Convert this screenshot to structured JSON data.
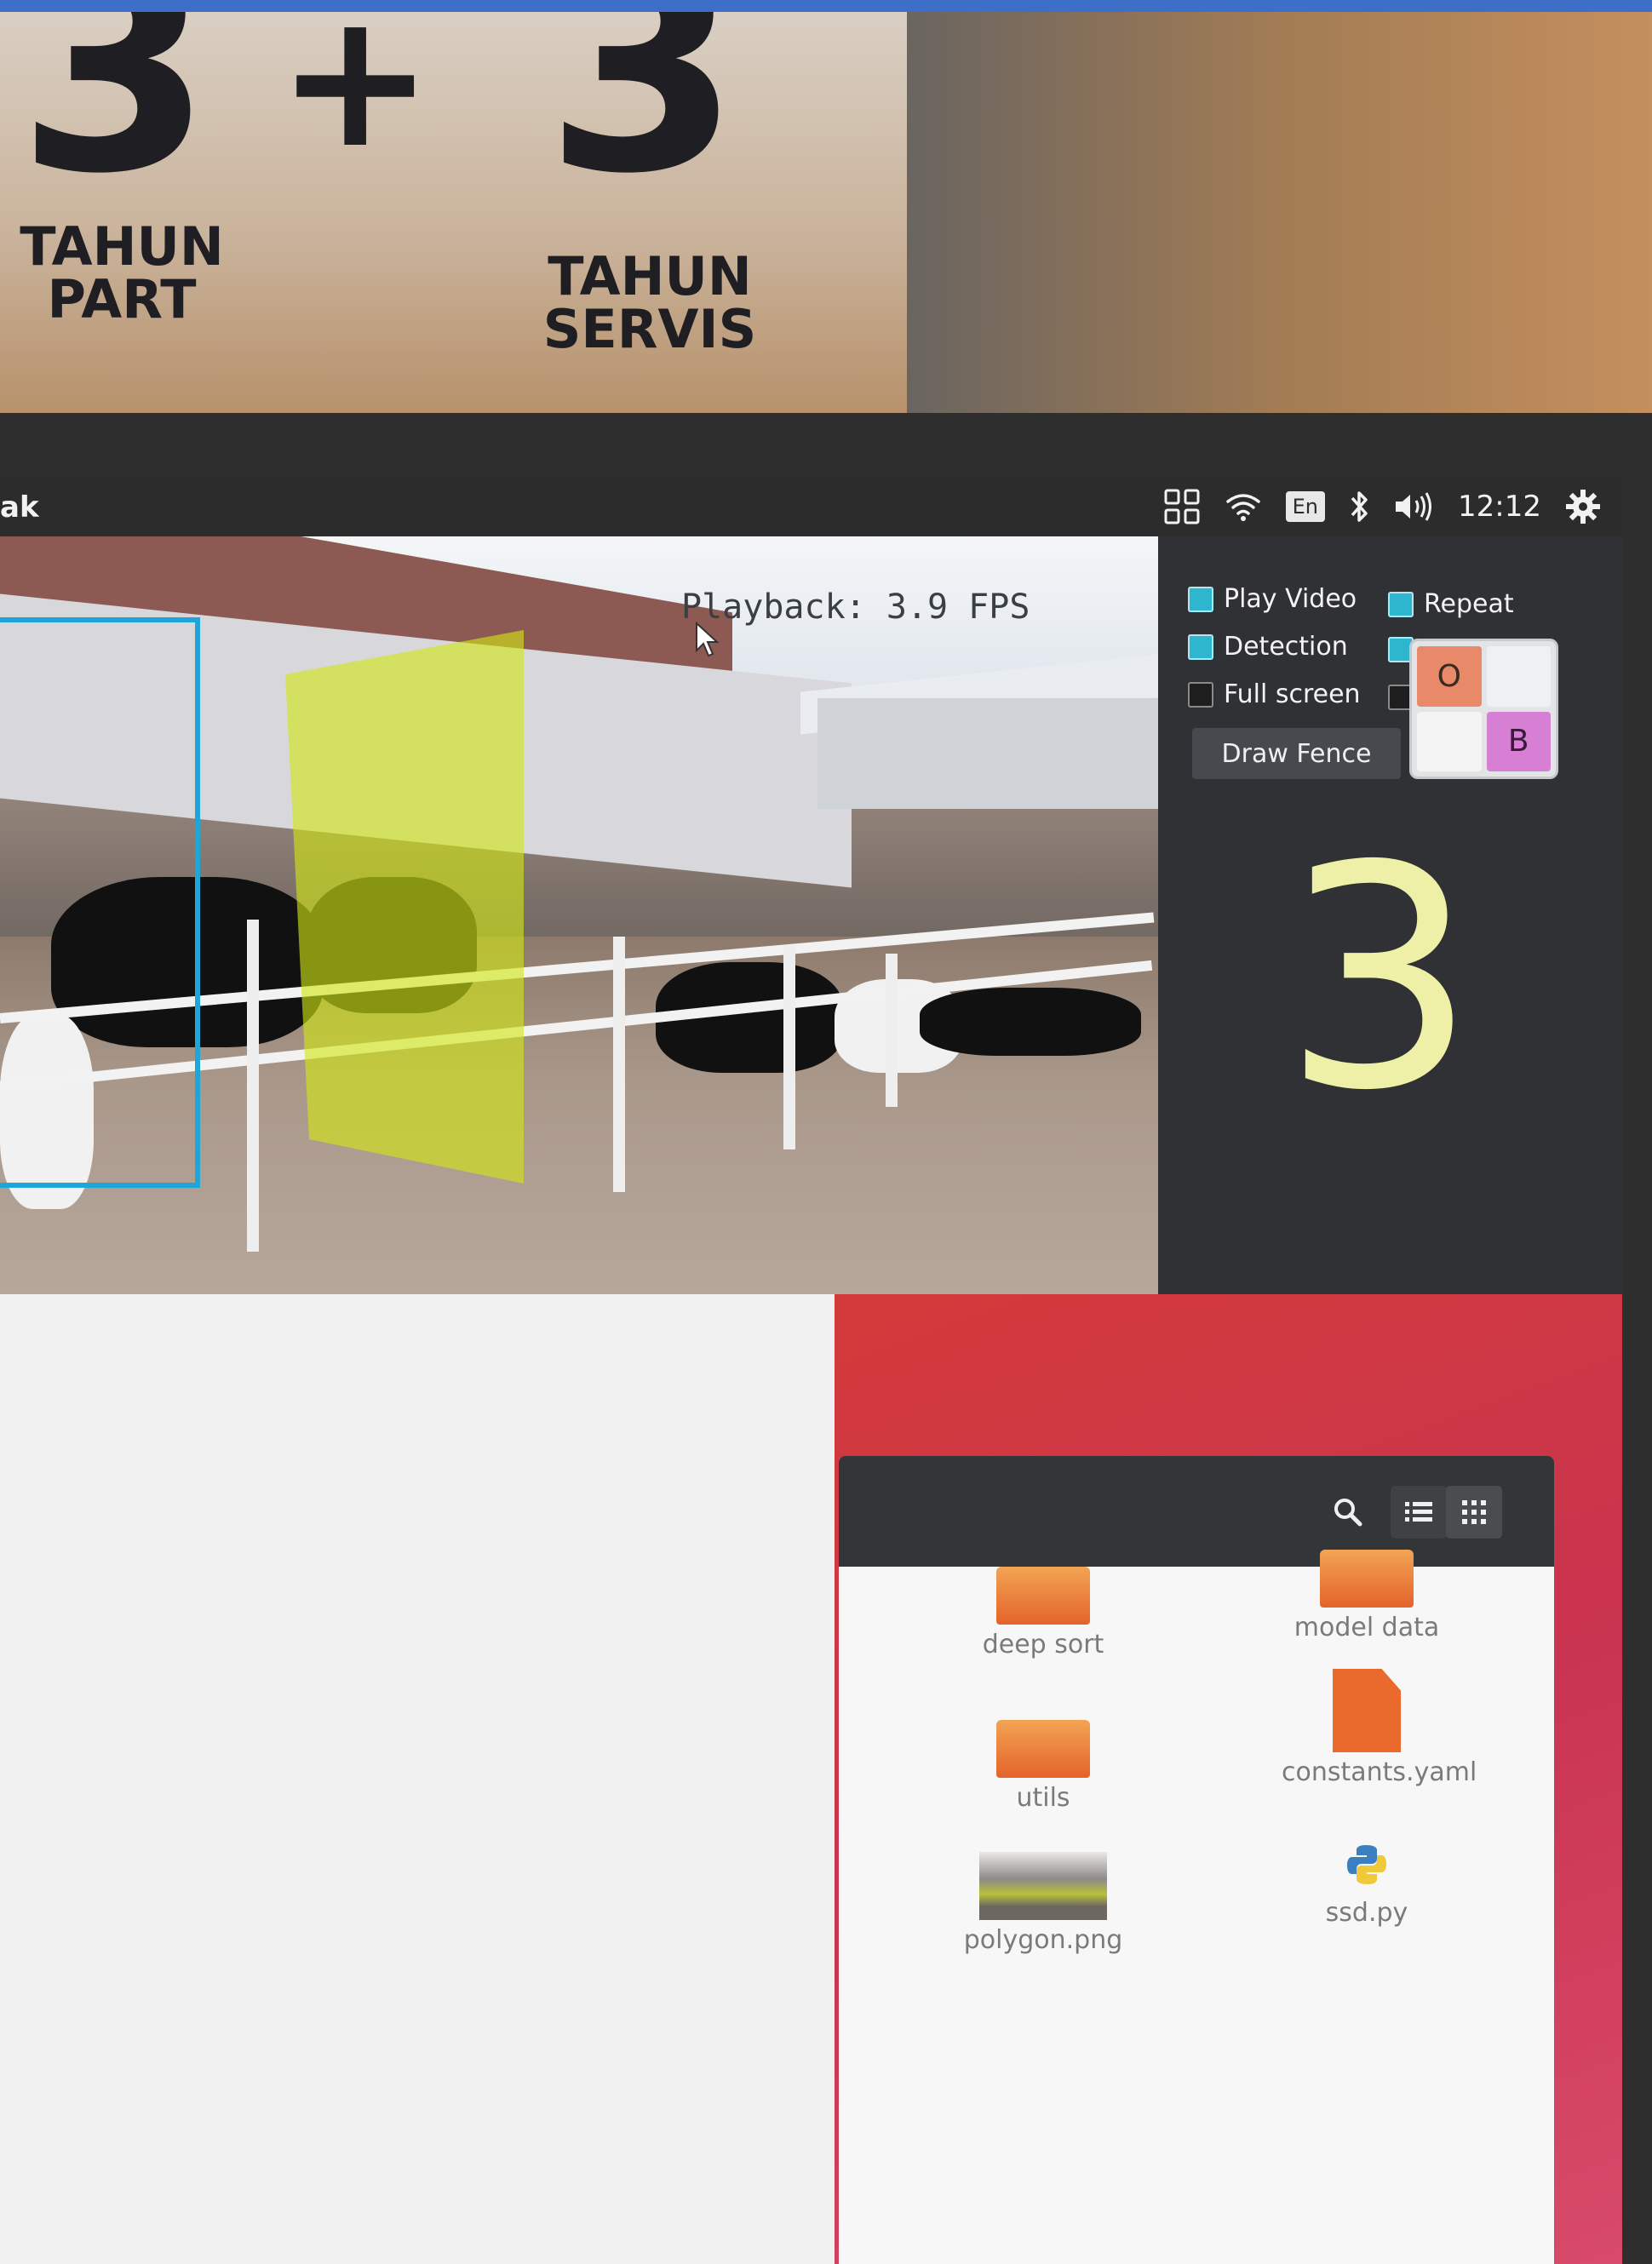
{
  "sign": {
    "digit_left": "3",
    "plus": "+",
    "digit_right": "3",
    "left_label": "TAHUN\nPART",
    "right_label": "TAHUN\nSERVIS"
  },
  "topbar": {
    "app_title": "ak",
    "lang": "En",
    "clock": "12:12"
  },
  "video": {
    "overlay_text": "Playback: 3.9 FPS"
  },
  "controls": {
    "play_video": "Play Video",
    "repeat": "Repeat",
    "detection": "Detection",
    "full_screen": "Full screen",
    "draw_fence_button": "Draw Fence",
    "zone_o": "O",
    "zone_b": "B",
    "count": "3",
    "states": {
      "play_video": true,
      "repeat": true,
      "detection": true,
      "full_screen": false
    }
  },
  "file_manager": {
    "items": [
      {
        "name": "deep sort",
        "type": "folder"
      },
      {
        "name": "model data",
        "type": "folder"
      },
      {
        "name": "utils",
        "type": "folder"
      },
      {
        "name": "constants.yaml",
        "type": "document"
      },
      {
        "name": "polygon.png",
        "type": "image"
      },
      {
        "name": "ssd.py",
        "type": "python"
      }
    ]
  },
  "colors": {
    "accent_checkbox": "#2fb6cf",
    "detection_box": "#1ea6d8",
    "fence_overlay": "#d2e614",
    "count_text": "#eef0a8",
    "desktop": "#d33a3a"
  }
}
